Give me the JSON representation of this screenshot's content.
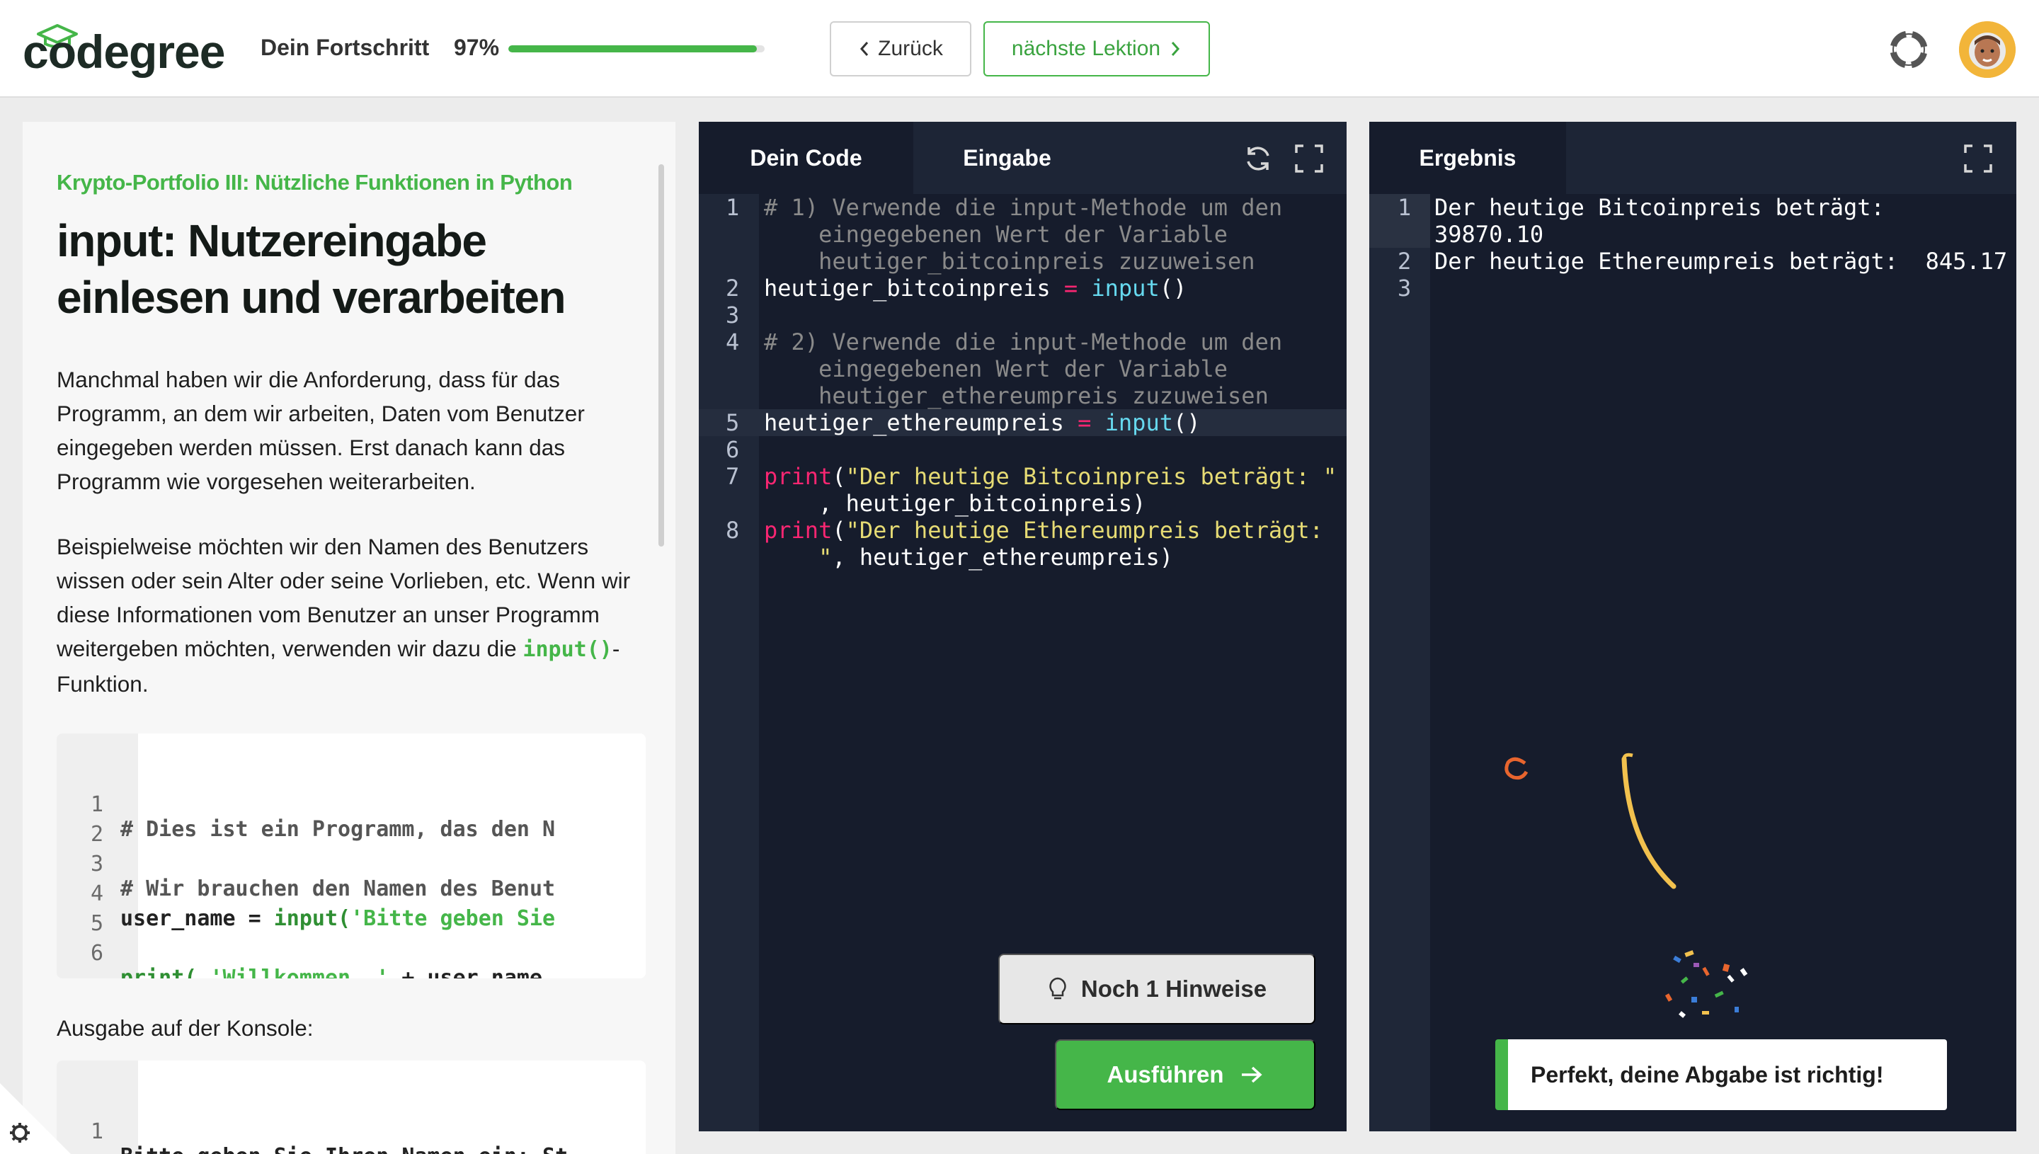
{
  "header": {
    "logo_text": "codegree",
    "progress_label": "Dein Fortschritt",
    "progress_percent_text": "97%",
    "progress_value": 0.97,
    "back_label": "Zurück",
    "next_label": "nächste Lektion",
    "icons": {
      "help": "lifebuoy-icon",
      "avatar": "astronaut-avatar",
      "back": "chevron-left-icon",
      "next": "chevron-right-icon"
    }
  },
  "lesson": {
    "breadcrumb": "Krypto-Portfolio III: Nützliche Funktionen in Python",
    "title": "input: Nutzereingabe einlesen und verarbeiten",
    "paragraph1": "Manchmal haben wir die Anforderung, dass für das Programm, an dem wir arbeiten, Daten vom Benutzer eingegeben werden müssen. Erst danach kann das Programm wie vorgesehen weiterarbeiten.",
    "paragraph2_before": "Beispielweise möchten wir den Namen des Benutzers wissen oder sein Alter oder seine Vorlieben, etc. Wenn wir diese Informationen vom Benutzer an unser Programm weitergeben möchten, verwenden wir dazu die ",
    "paragraph2_code": "input()",
    "paragraph2_after": "-Funktion.",
    "example_lines": [
      {
        "num": "1",
        "comment": "# Dies ist ein Programm, das den N"
      },
      {
        "num": "2"
      },
      {
        "num": "3",
        "comment": "# Wir brauchen den Namen des Benut"
      },
      {
        "num": "4",
        "var": "user_name = ",
        "fn": "input(",
        "str": "'Bitte geben Sie"
      },
      {
        "num": "5"
      },
      {
        "num": "6",
        "fn": "print( ",
        "str": "'Willkommen, '",
        "rest": " + user_name"
      }
    ],
    "console_label": "Ausgabe auf der Konsole:",
    "console_lines": [
      {
        "num": "1",
        "text": "Bitte geben Sie Ihren Namen ein: St"
      }
    ]
  },
  "editor": {
    "tab_code": "Dein Code",
    "tab_input": "Eingabe",
    "icons": {
      "reset": "refresh-icon",
      "fullscreen": "fullscreen-icon"
    },
    "line_numbers": [
      "1",
      "2",
      "3",
      "4",
      "5",
      "6",
      "7",
      "8"
    ],
    "code": {
      "l1a": "# 1) Verwende die input-Methode um den",
      "l1b": "    eingegebenen Wert der Variable",
      "l1c": "    heutiger_bitcoinpreis zuzuweisen",
      "l2_var": "heutiger_bitcoinpreis ",
      "l2_op": "=",
      "l2_fn": " input",
      "l2_par": "()",
      "l4a": "# 2) Verwende die input-Methode um den",
      "l4b": "    eingegebenen Wert der Variable",
      "l4c": "    heutiger_ethereumpreis zuzuweisen",
      "l5_var": "heutiger_ethereumpreis ",
      "l5_op": "=",
      "l5_fn": " input",
      "l5_par": "()",
      "l7_kw": "print",
      "l7_p": "(",
      "l7_str": "\"Der heutige Bitcoinpreis beträgt: \"",
      "l7b": "    , heutiger_bitcoinpreis)",
      "l8_kw": "print",
      "l8_p": "(",
      "l8_str": "\"Der heutige Ethereumpreis beträgt:",
      "l8b_str": "    \"",
      "l8b_rest": ", heutiger_ethereumpreis)"
    },
    "hint_button": "Noch 1 Hinweise",
    "run_button": "Ausführen",
    "icons_buttons": {
      "hint": "lightbulb-icon",
      "run": "arrow-right-icon"
    }
  },
  "result": {
    "tab_label": "Ergebnis",
    "icon": "fullscreen-icon",
    "line_numbers": [
      "1",
      "2",
      "3"
    ],
    "output": {
      "l1a": "Der heutige Bitcoinpreis beträgt:",
      "l1b": "39870.10",
      "l2": "Der heutige Ethereumpreis beträgt:  845.17"
    },
    "toast": "Perfekt, deine Abgabe ist richtig!"
  },
  "colors": {
    "accent": "#45b649",
    "editor_bg": "#161c2c",
    "gutter_bg": "#1f2738"
  }
}
